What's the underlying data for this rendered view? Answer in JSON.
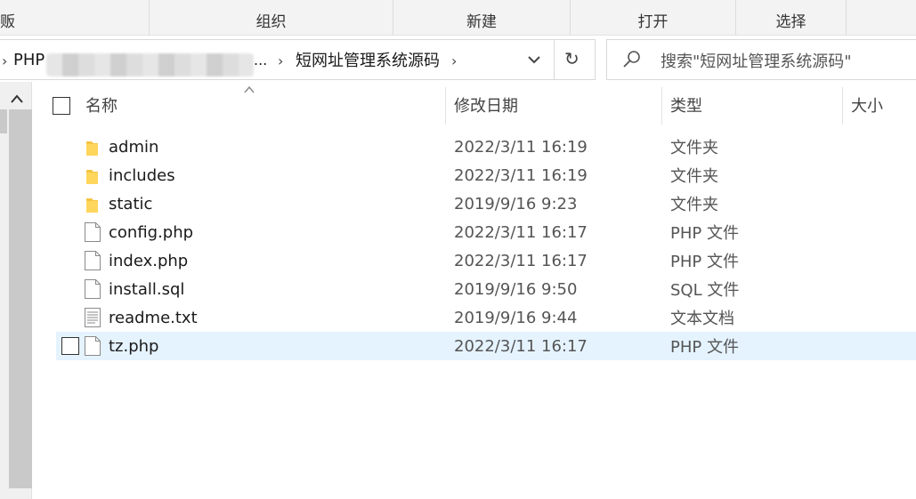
{
  "ribbon": {
    "cut_label": "贩",
    "organize": "组织",
    "new": "新建",
    "open": "打开",
    "select": "选择"
  },
  "address": {
    "root_crumb": "PHP",
    "ellipsis": "...",
    "current_crumb": "短网址管理系统源码",
    "refresh_glyph": "↻"
  },
  "search": {
    "placeholder": "搜索\"短网址管理系统源码\""
  },
  "columns": {
    "name": "名称",
    "modified": "修改日期",
    "type": "类型",
    "size": "大小"
  },
  "files": [
    {
      "name": "admin",
      "modified": "2022/3/11 16:19",
      "type": "文件夹",
      "icon": "folder-icon"
    },
    {
      "name": "includes",
      "modified": "2022/3/11 16:19",
      "type": "文件夹",
      "icon": "folder-icon"
    },
    {
      "name": "static",
      "modified": "2019/9/16 9:23",
      "type": "文件夹",
      "icon": "folder-icon"
    },
    {
      "name": "config.php",
      "modified": "2022/3/11 16:17",
      "type": "PHP 文件",
      "icon": "file-icon"
    },
    {
      "name": "index.php",
      "modified": "2022/3/11 16:17",
      "type": "PHP 文件",
      "icon": "file-icon"
    },
    {
      "name": "install.sql",
      "modified": "2019/9/16 9:50",
      "type": "SQL 文件",
      "icon": "file-icon"
    },
    {
      "name": "readme.txt",
      "modified": "2019/9/16 9:44",
      "type": "文本文档",
      "icon": "text-file-icon"
    },
    {
      "name": "tz.php",
      "modified": "2022/3/11 16:17",
      "type": "PHP 文件",
      "icon": "file-icon",
      "selected": true
    }
  ],
  "colors": {
    "selection": "#e5f3ff",
    "folder": "#f5c542",
    "ribbon_bg": "#f3f3f3"
  }
}
